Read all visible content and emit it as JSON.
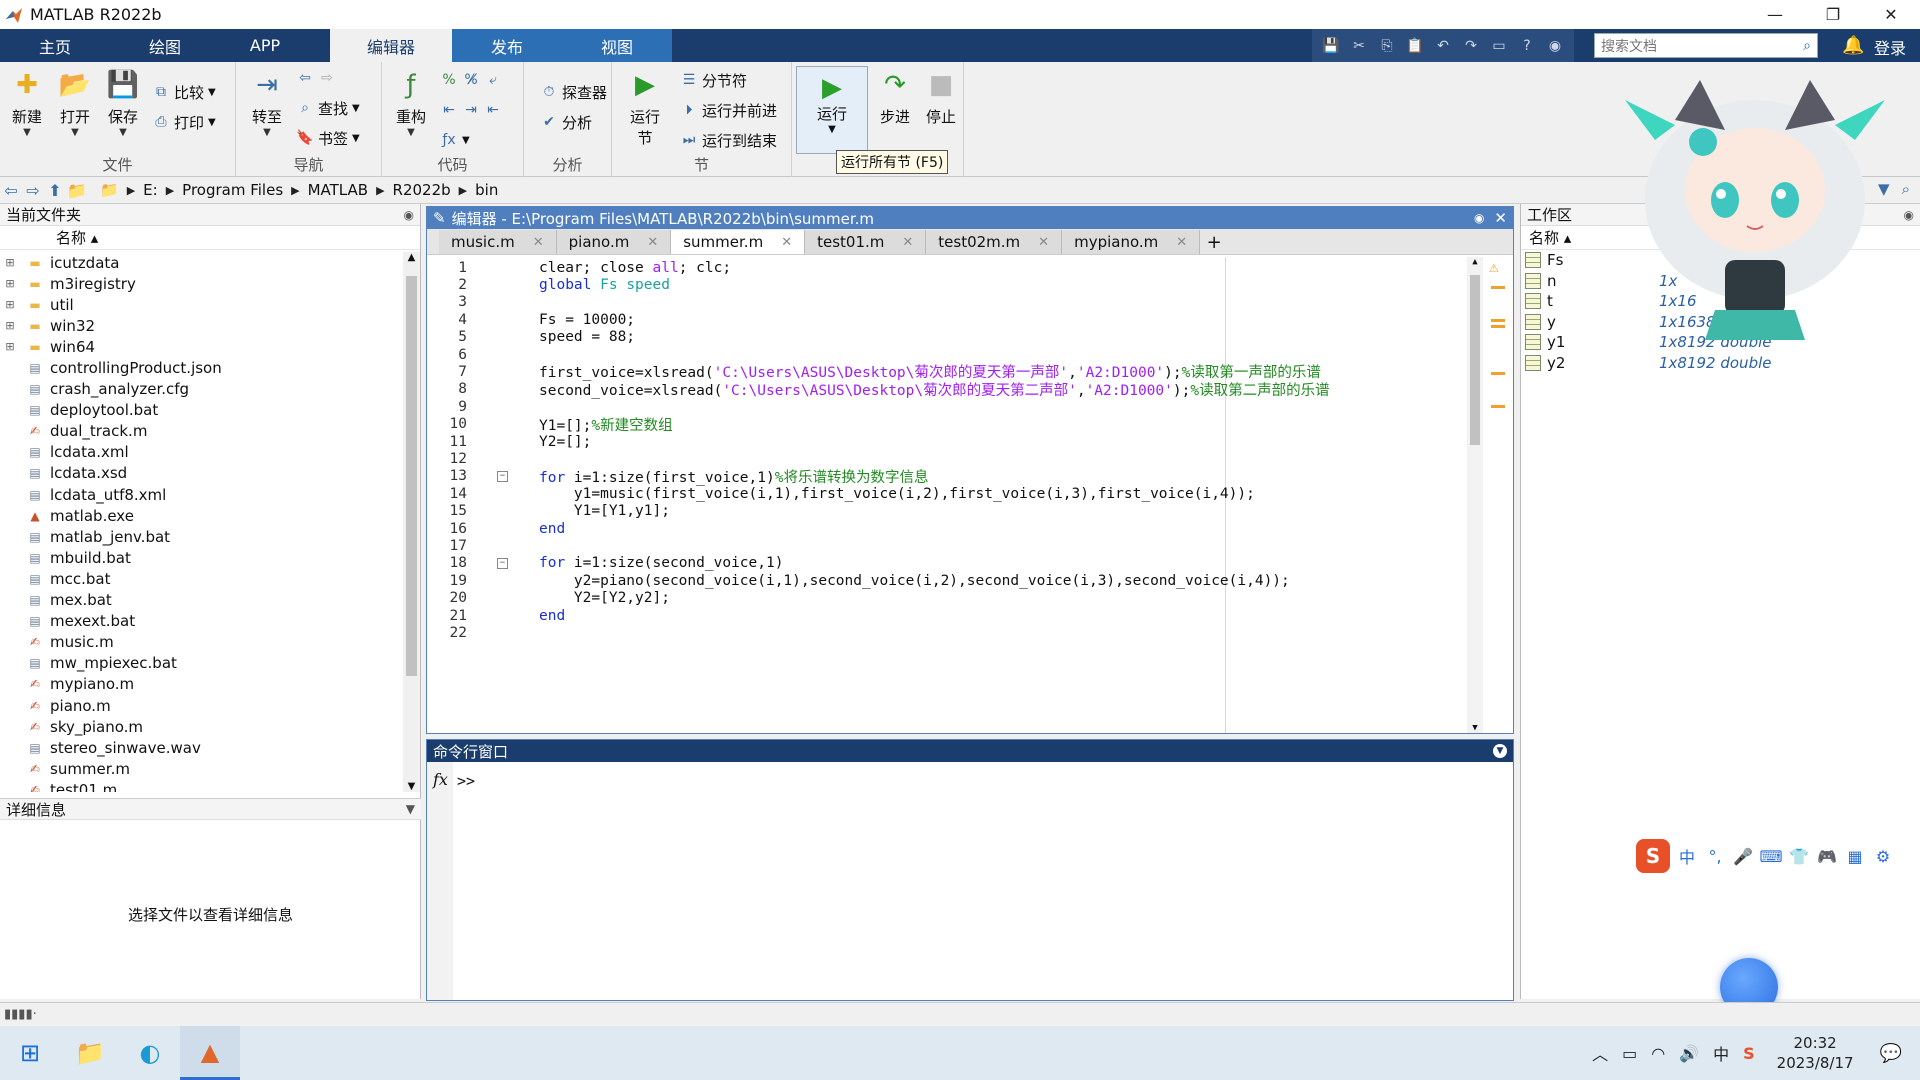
{
  "window": {
    "title": "MATLAB R2022b",
    "minimize": "—",
    "restore": "❐",
    "close": "✕"
  },
  "ribbon_tabs": [
    "主页",
    "绘图",
    "APP",
    "编辑器",
    "发布",
    "视图"
  ],
  "search": {
    "placeholder": "搜索文档"
  },
  "login_label": "登录",
  "ribbon": {
    "file_group": {
      "label": "文件",
      "new": "新建",
      "open": "打开",
      "save": "保存",
      "compare": "比较",
      "print": "打印"
    },
    "nav_group": {
      "label": "导航",
      "goto": "转至",
      "find": "查找",
      "bookmark": "书签"
    },
    "code_group": {
      "label": "代码",
      "refactor": "重构"
    },
    "analyze_group": {
      "label": "分析",
      "profiler": "探查器",
      "analyze": "分析"
    },
    "section_group": {
      "label": "节",
      "run_section_line1": "运行",
      "run_section_line2": "节",
      "section_break": "分节符",
      "run_advance": "运行并前进",
      "run_to_end": "运行到结束"
    },
    "run_group": {
      "label": "运行",
      "run": "运行",
      "step": "步进",
      "stop": "停止"
    },
    "tooltip": "运行所有节 (F5)"
  },
  "address": {
    "crumbs": [
      "E:",
      "Program Files",
      "MATLAB",
      "R2022b",
      "bin"
    ]
  },
  "current_folder": {
    "title": "当前文件夹",
    "col_name": "名称 ▴",
    "items": [
      {
        "name": "icutzdata",
        "type": "folder"
      },
      {
        "name": "m3iregistry",
        "type": "folder"
      },
      {
        "name": "util",
        "type": "folder"
      },
      {
        "name": "win32",
        "type": "folder"
      },
      {
        "name": "win64",
        "type": "folder"
      },
      {
        "name": "controllingProduct.json",
        "type": "file"
      },
      {
        "name": "crash_analyzer.cfg",
        "type": "file"
      },
      {
        "name": "deploytool.bat",
        "type": "file"
      },
      {
        "name": "dual_track.m",
        "type": "m"
      },
      {
        "name": "lcdata.xml",
        "type": "file"
      },
      {
        "name": "lcdata.xsd",
        "type": "file"
      },
      {
        "name": "lcdata_utf8.xml",
        "type": "file"
      },
      {
        "name": "matlab.exe",
        "type": "exe"
      },
      {
        "name": "matlab_jenv.bat",
        "type": "file"
      },
      {
        "name": "mbuild.bat",
        "type": "file"
      },
      {
        "name": "mcc.bat",
        "type": "file"
      },
      {
        "name": "mex.bat",
        "type": "file"
      },
      {
        "name": "mexext.bat",
        "type": "file"
      },
      {
        "name": "music.m",
        "type": "m"
      },
      {
        "name": "mw_mpiexec.bat",
        "type": "file"
      },
      {
        "name": "mypiano.m",
        "type": "m"
      },
      {
        "name": "piano.m",
        "type": "m"
      },
      {
        "name": "sky_piano.m",
        "type": "m"
      },
      {
        "name": "stereo_sinwave.wav",
        "type": "file"
      },
      {
        "name": "summer.m",
        "type": "m"
      },
      {
        "name": "test01.m",
        "type": "m"
      }
    ]
  },
  "details": {
    "title": "详细信息",
    "message": "选择文件以查看详细信息"
  },
  "editor": {
    "title": "编辑器 - E:\\Program Files\\MATLAB\\R2022b\\bin\\summer.m",
    "tabs": [
      "music.m",
      "piano.m",
      "summer.m",
      "test01.m",
      "test02m.m",
      "mypiano.m"
    ],
    "active_tab": "summer.m",
    "lines": [
      {
        "n": "1",
        "html": "clear; close <span class='str'>all</span>; clc;"
      },
      {
        "n": "2",
        "html": "<span class='kw'>global</span> <span class='glob'>Fs</span> <span class='glob'>speed</span>"
      },
      {
        "n": "3",
        "html": ""
      },
      {
        "n": "4",
        "html": "Fs = 10000;"
      },
      {
        "n": "5",
        "html": "speed = 88;"
      },
      {
        "n": "6",
        "html": ""
      },
      {
        "n": "7",
        "html": "first_voice=xlsread(<span class='str'>'C:\\Users\\ASUS\\Desktop\\菊次郎的夏天第一声部'</span>,<span class='str'>'A2:D1000'</span>);<span class='cmt'>%读取第一声部的乐谱</span>"
      },
      {
        "n": "8",
        "html": "second_voice=xlsread(<span class='str'>'C:\\Users\\ASUS\\Desktop\\菊次郎的夏天第二声部'</span>,<span class='str'>'A2:D1000'</span>);<span class='cmt'>%读取第二声部的乐谱</span>"
      },
      {
        "n": "9",
        "html": ""
      },
      {
        "n": "10",
        "html": "Y1=[];<span class='cmt'>%新建空数组</span>"
      },
      {
        "n": "11",
        "html": "Y2=[];"
      },
      {
        "n": "12",
        "html": ""
      },
      {
        "n": "13",
        "html": "<span class='kw'>for</span> i=1:size(first_voice,1)<span class='cmt'>%将乐谱转换为数字信息</span>"
      },
      {
        "n": "14",
        "html": "    y1=music(first_voice(i,1),first_voice(i,2),first_voice(i,3),first_voice(i,4));"
      },
      {
        "n": "15",
        "html": "    Y1=[Y1,y1];"
      },
      {
        "n": "16",
        "html": "<span class='kw'>end</span>"
      },
      {
        "n": "17",
        "html": ""
      },
      {
        "n": "18",
        "html": "<span class='kw'>for</span> i=1:size(second_voice,1)"
      },
      {
        "n": "19",
        "html": "    y2=piano(second_voice(i,1),second_voice(i,2),second_voice(i,3),second_voice(i,4));"
      },
      {
        "n": "20",
        "html": "    Y2=[Y2,y2];"
      },
      {
        "n": "21",
        "html": "<span class='kw'>end</span>"
      },
      {
        "n": "22",
        "html": ""
      }
    ]
  },
  "command_window": {
    "title": "命令行窗口",
    "fx": "fx",
    "prompt": ">>"
  },
  "workspace": {
    "title": "工作区",
    "col_name": "名称 ▴",
    "vars": [
      {
        "name": "Fs",
        "value": ""
      },
      {
        "name": "n",
        "value": "1x"
      },
      {
        "name": "t",
        "value": "1x16"
      },
      {
        "name": "y",
        "value": "1x16384 double"
      },
      {
        "name": "y1",
        "value": "1x8192 double"
      },
      {
        "name": "y2",
        "value": "1x8192 double"
      }
    ]
  },
  "taskbar": {
    "time": "20:32",
    "date": "2023/8/17",
    "ime_lang": "中"
  },
  "colors": {
    "ribbon_tab_bar": "#1a3d6e",
    "editor_title": "#4f7fbf",
    "keyword": "#1a2fcf",
    "string": "#a020f0",
    "comment": "#228b22"
  }
}
